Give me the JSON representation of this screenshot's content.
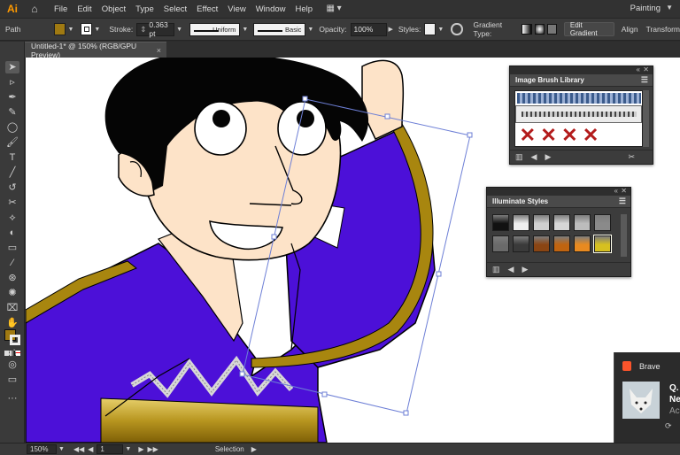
{
  "app": {
    "logo": "Ai",
    "workspace": "Painting"
  },
  "menus": [
    "File",
    "Edit",
    "Object",
    "Type",
    "Select",
    "Effect",
    "View",
    "Window",
    "Help"
  ],
  "control_bar": {
    "selection_type": "Path",
    "fill_color": "#a07a12",
    "stroke_label": "Stroke:",
    "stroke_weight": "0.363 pt",
    "profile": "Uniform",
    "brush": "Basic",
    "opacity_label": "Opacity:",
    "opacity_value": "100%",
    "styles_label": "Styles:",
    "gradient_type_label": "Gradient Type:",
    "edit_gradient": "Edit Gradient",
    "align": "Align",
    "transform": "Transform"
  },
  "document_tab": {
    "title": "Untitled-1* @ 150% (RGB/GPU Preview)",
    "close": "×"
  },
  "tools": [
    "selection-tool",
    "direct-selection-tool",
    "pen-tool",
    "curvature-tool",
    "ellipse-tool",
    "paintbrush-tool",
    "type-tool",
    "line-tool",
    "rotate-tool",
    "scissors-tool",
    "width-tool",
    "shape-builder-tool",
    "gradient-tool",
    "eyedropper-tool",
    "blend-tool",
    "symbol-sprayer-tool",
    "artboard-tool",
    "slice-tool",
    "zoom-tool",
    "hand-tool"
  ],
  "panels": {
    "brush_library": {
      "title": "Image Brush Library"
    },
    "illuminate_styles": {
      "title": "Illuminate Styles",
      "swatches": [
        [
          "#111111",
          "#eeeeee",
          "#cfcfcf",
          "#d6d6d6",
          "#bcbcbc",
          "#8a8a8a"
        ],
        [
          "#6a6a6a",
          "#3a3a3a",
          "#8a4513",
          "#c06410",
          "#e88a20",
          "#d6c020"
        ]
      ]
    }
  },
  "status_bar": {
    "zoom": "150%",
    "artboard": "1",
    "tool": "Selection"
  },
  "notification": {
    "app": "Brave",
    "line1": "Q.",
    "line2": "Ne",
    "line3": "Ac",
    "line4": "⟳"
  },
  "colors": {
    "robe": "#4c10d8",
    "trim": "#a8860f",
    "skin": "#fde3c8",
    "hair": "#050505",
    "selection": "#6d7fd6"
  }
}
